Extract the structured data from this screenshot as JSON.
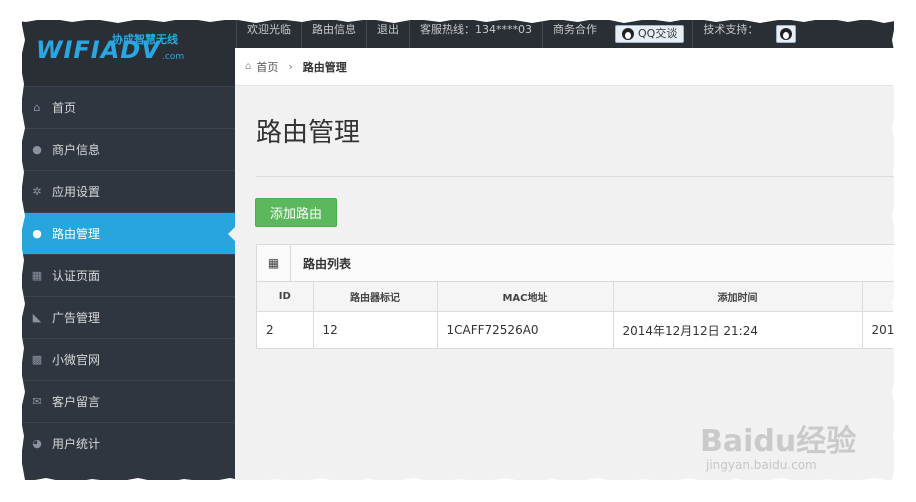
{
  "topbar": {
    "links": [
      "欢迎光临",
      "路由信息",
      "退出",
      "客服热线：134****03",
      "商务合作"
    ],
    "qq_button": "QQ交谈",
    "support_label": "技术支持："
  },
  "logo": {
    "brand": "WIFIADV",
    "tagline": "协成智慧无线",
    "domain": ".com"
  },
  "sidebar": {
    "items": [
      {
        "label": "首页",
        "icon": "home-icon"
      },
      {
        "label": "商户信息",
        "icon": "users-icon"
      },
      {
        "label": "应用设置",
        "icon": "cogs-icon"
      },
      {
        "label": "路由管理",
        "icon": "users-icon",
        "active": true
      },
      {
        "label": "认证页面",
        "icon": "grid-icon"
      },
      {
        "label": "广告管理",
        "icon": "bullhorn-icon"
      },
      {
        "label": "小微官网",
        "icon": "tiles-icon"
      },
      {
        "label": "客户留言",
        "icon": "envelope-icon"
      },
      {
        "label": "用户统计",
        "icon": "user-icon"
      }
    ]
  },
  "breadcrumb": {
    "home": "首页",
    "current": "路由管理"
  },
  "main": {
    "title": "路由管理",
    "add_button": "添加路由",
    "panel_title": "路由列表",
    "table": {
      "headers": [
        "ID",
        "路由器标记",
        "MAC地址",
        "添加时间",
        ""
      ],
      "rows": [
        [
          "2",
          "12",
          "1CAFF72526A0",
          "2014年12月12日 21:24",
          "201"
        ]
      ]
    }
  },
  "watermark": {
    "text": "Baidu经验",
    "sub": "jingyan.baidu.com"
  },
  "colors": {
    "sidebar_bg": "#2f3640",
    "active_item": "#27a5dc",
    "add_button": "#5cb85c",
    "topbar_bg": "#2a2f36"
  }
}
